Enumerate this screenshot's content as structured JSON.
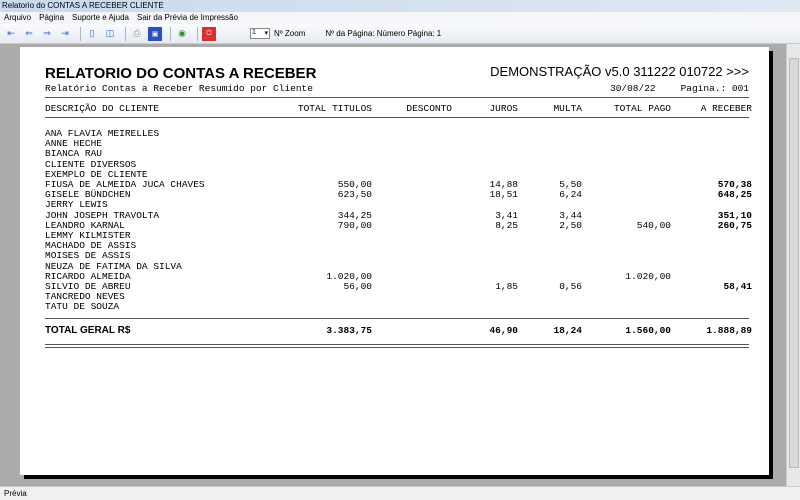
{
  "window": {
    "title": "Relatorio do CONTAS A RECEBER CLIENTE"
  },
  "menu": [
    "Arquivo",
    "Página",
    "Suporte e Ajuda",
    "Sair da Prévia de Impressão"
  ],
  "toolbar": {
    "zoom_value": "1",
    "zoom_label": "Nº Zoom",
    "page_label": "Nº da Página: Número Página: 1"
  },
  "report": {
    "title": "RELATORIO DO CONTAS A RECEBER",
    "demo": "DEMONSTRAÇÃO v5.0 311222 010722 >>>",
    "subtitle": "Relatório Contas a Receber Resumido por Cliente",
    "date": "30/08/22",
    "page": "Pagina.: 001",
    "columns": [
      "DESCRIÇÃO DO CLIENTE",
      "TOTAL TITULOS",
      "DESCONTO",
      "JUROS",
      "MULTA",
      "TOTAL PAGO",
      "A RECEBER"
    ],
    "rows": [
      [
        "ANA FLAVIA MEIRELLES",
        "",
        "",
        "",
        "",
        "",
        ""
      ],
      [
        "ANNE HECHE",
        "",
        "",
        "",
        "",
        "",
        ""
      ],
      [
        "BIANCA RAU",
        "",
        "",
        "",
        "",
        "",
        ""
      ],
      [
        "CLIENTE DIVERSOS",
        "",
        "",
        "",
        "",
        "",
        ""
      ],
      [
        "EXEMPLO DE CLIENTE",
        "",
        "",
        "",
        "",
        "",
        ""
      ],
      [
        "FIUSA DE ALMEIDA JUCA CHAVES",
        "550,00",
        "",
        "14,88",
        "5,50",
        "",
        "570,38"
      ],
      [
        "GISELE BÜNDCHEN",
        "623,50",
        "",
        "18,51",
        "6,24",
        "",
        "648,25"
      ],
      [
        "JERRY LEWIS",
        "",
        "",
        "",
        "",
        "",
        ""
      ],
      [
        "JOHN JOSEPH TRAVOLTA",
        "344,25",
        "",
        "3,41",
        "3,44",
        "",
        "351,10"
      ],
      [
        "LEANDRO KARNAL",
        "790,00",
        "",
        "8,25",
        "2,50",
        "540,00",
        "260,75"
      ],
      [
        "LEMMY KILMISTER",
        "",
        "",
        "",
        "",
        "",
        ""
      ],
      [
        "MACHADO DE ASSIS",
        "",
        "",
        "",
        "",
        "",
        ""
      ],
      [
        "MOISES DE ASSIS",
        "",
        "",
        "",
        "",
        "",
        ""
      ],
      [
        "NEUZA DE FATIMA DA SILVA",
        "",
        "",
        "",
        "",
        "",
        ""
      ],
      [
        "RICARDO ALMEIDA",
        "1.020,00",
        "",
        "",
        "",
        "1.020,00",
        ""
      ],
      [
        "SILVIO DE ABREU",
        "56,00",
        "",
        "1,85",
        "0,56",
        "",
        "58,41"
      ],
      [
        "TANCREDO NEVES",
        "",
        "",
        "",
        "",
        "",
        ""
      ],
      [
        "TATU DE SOUZA",
        "",
        "",
        "",
        "",
        "",
        ""
      ]
    ],
    "total": {
      "label": "TOTAL GERAL R$",
      "total_titulos": "3.383,75",
      "desconto": "",
      "juros": "46,90",
      "multa": "18,24",
      "total_pago": "1.560,00",
      "a_receber": "1.888,89"
    }
  },
  "status": "Prévia"
}
